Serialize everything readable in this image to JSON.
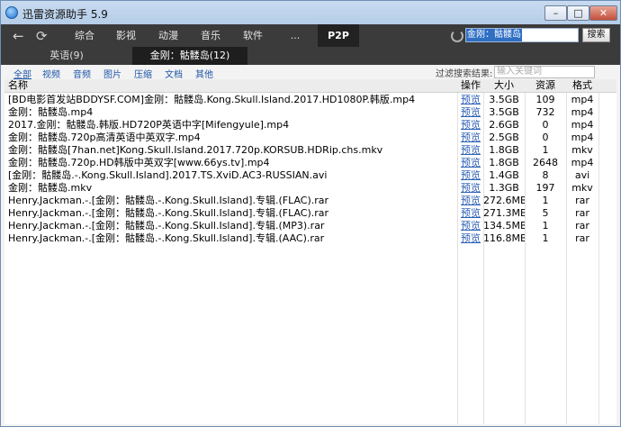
{
  "window": {
    "title": "迅雷资源助手 5.9",
    "controls": {
      "minimize": "–",
      "maximize": "□",
      "close": "✕"
    }
  },
  "nav": {
    "back_icon": "back-arrow-icon",
    "refresh_icon": "refresh-icon",
    "categories": [
      "综合",
      "影视",
      "动漫",
      "音乐",
      "软件",
      "...",
      "P2P"
    ],
    "active_category": "P2P"
  },
  "search": {
    "value": "金刚：骷髅岛",
    "button_label": "搜索"
  },
  "subtabs": [
    {
      "label": "英语(9)",
      "active": false
    },
    {
      "label": "金刚：骷髅岛(12)",
      "active": true
    }
  ],
  "filters": {
    "types": [
      "全部",
      "视频",
      "音频",
      "图片",
      "压缩",
      "文档",
      "其他"
    ],
    "active": "全部",
    "result_filter_label": "过滤搜索结果:",
    "result_filter_placeholder": "输入关键词"
  },
  "table": {
    "columns": [
      "名称",
      "操作",
      "大小",
      "资源",
      "格式"
    ],
    "rows": [
      {
        "name": "[BD电影首发站BDDYSF.COM]金刚：骷髅岛.Kong.Skull.Island.2017.HD1080P.韩版.mp4",
        "op": "预览",
        "size": "3.5GB",
        "sources": "109",
        "format": "mp4"
      },
      {
        "name": "金刚：骷髅岛.mp4",
        "op": "预览",
        "size": "3.5GB",
        "sources": "732",
        "format": "mp4"
      },
      {
        "name": "2017.金刚：骷髅岛.韩版.HD720P英语中字[Mifengyule].mp4",
        "op": "预览",
        "size": "2.6GB",
        "sources": "0",
        "format": "mp4"
      },
      {
        "name": "金刚：骷髅岛.720p高清英语中英双字.mp4",
        "op": "预览",
        "size": "2.5GB",
        "sources": "0",
        "format": "mp4"
      },
      {
        "name": "金刚：骷髅岛[7han.net]Kong.Skull.Island.2017.720p.KORSUB.HDRip.chs.mkv",
        "op": "预览",
        "size": "1.8GB",
        "sources": "1",
        "format": "mkv"
      },
      {
        "name": "金刚：骷髅岛.720p.HD韩版中英双字[www.66ys.tv].mp4",
        "op": "预览",
        "size": "1.8GB",
        "sources": "2648",
        "format": "mp4"
      },
      {
        "name": "[金刚：骷髅岛.-.Kong.Skull.Island].2017.TS.XviD.AC3-RUSSIAN.avi",
        "op": "预览",
        "size": "1.4GB",
        "sources": "8",
        "format": "avi"
      },
      {
        "name": "金刚：骷髅岛.mkv",
        "op": "预览",
        "size": "1.3GB",
        "sources": "197",
        "format": "mkv"
      },
      {
        "name": "Henry.Jackman.-.[金刚：骷髅岛.-.Kong.Skull.Island].专辑.(FLAC).rar",
        "op": "预览",
        "size": "272.6MB",
        "sources": "1",
        "format": "rar"
      },
      {
        "name": "Henry.Jackman.-.[金刚：骷髅岛.-.Kong.Skull.Island].专辑.(FLAC).rar",
        "op": "预览",
        "size": "271.3MB",
        "sources": "5",
        "format": "rar"
      },
      {
        "name": "Henry.Jackman.-.[金刚：骷髅岛.-.Kong.Skull.Island].专辑.(MP3).rar",
        "op": "预览",
        "size": "134.5MB",
        "sources": "1",
        "format": "rar"
      },
      {
        "name": "Henry.Jackman.-.[金刚：骷髅岛.-.Kong.Skull.Island].专辑.(AAC).rar",
        "op": "预览",
        "size": "116.8MB",
        "sources": "1",
        "format": "rar"
      }
    ]
  }
}
